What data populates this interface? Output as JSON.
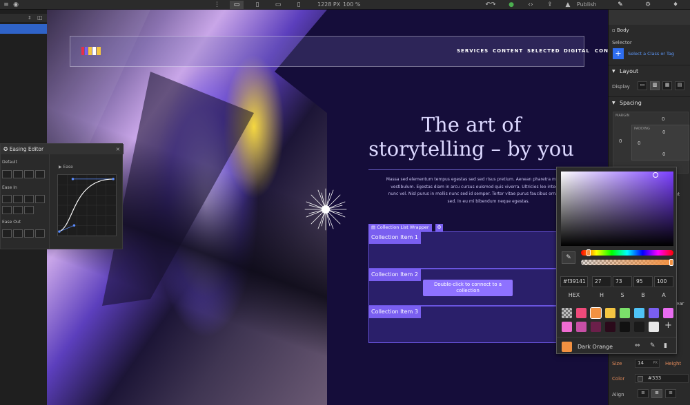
{
  "toolbar": {
    "viewport_width": "1228 PX",
    "zoom": "100 %",
    "publish_label": "Publish"
  },
  "site": {
    "nav_links": [
      "SERVICES",
      "CONTENT",
      "SELECTED",
      "DIGITAL",
      "CONTACT"
    ],
    "headline_line1": "The art of",
    "headline_line2": "storytelling – by you",
    "body_text": "Massa sed elementum tempus egestas sed sed risus pretium. Aenean pharetra magna ac placerat vestibulum. Egestas diam in arcu cursus euismod quis viverra. Ultricies leo integer malesuada nunc vel. Nisl purus in mollis nunc sed id semper. Tortor vitae purus faucibus ornare suspendisse sed. In eu mi bibendum neque egestas.",
    "collection_wrapper_label": "Collection List Wrapper",
    "collection_items": [
      "Collection Item 1",
      "Collection Item 2",
      "Collection Item 3"
    ],
    "connect_hint": "Double-click to connect to a collection"
  },
  "easing_editor": {
    "title": "Easing Editor",
    "sections": [
      "Default",
      "Ease In",
      "Ease Out"
    ],
    "curve_label": "Ease"
  },
  "style_panel": {
    "element": "Body",
    "selector_label": "Selector",
    "selector_placeholder": "Select a Class or Tag",
    "layout_label": "Layout",
    "display_label": "Display",
    "spacing_label": "Spacing",
    "margin_label": "MARGIN",
    "padding_label": "PADDING",
    "margin_top": "0",
    "margin_left": "0",
    "padding_top": "0",
    "padding_left": "0",
    "padding_bottom": "0",
    "margin_bottom": "0",
    "size_label": "Size",
    "size_value": "14",
    "size_unit": "PX",
    "height_label": "Height",
    "color_label": "Color",
    "color_value": "#333",
    "align_label": "Align",
    "side_h": "ht",
    "side_t": "t",
    "side_lear": "lear"
  },
  "color_picker": {
    "hex": "#f39141",
    "h": "27",
    "s": "73",
    "b": "95",
    "a": "100",
    "labels": [
      "HEX",
      "H",
      "S",
      "B",
      "A"
    ],
    "swatch_name": "Dark Orange",
    "swatches_row1": [
      "transparent",
      "#ef4a7a",
      "#f39141",
      "#f4c542",
      "#7be06a",
      "#4fc3f7",
      "#7a5ff0",
      "#e86cf0"
    ],
    "swatches_row2": [
      "#f06cd2",
      "#c84fa6",
      "#6b1f4a",
      "#2a0a1a",
      "#111111",
      "#1a1a1a",
      "#e8e8e8"
    ]
  }
}
